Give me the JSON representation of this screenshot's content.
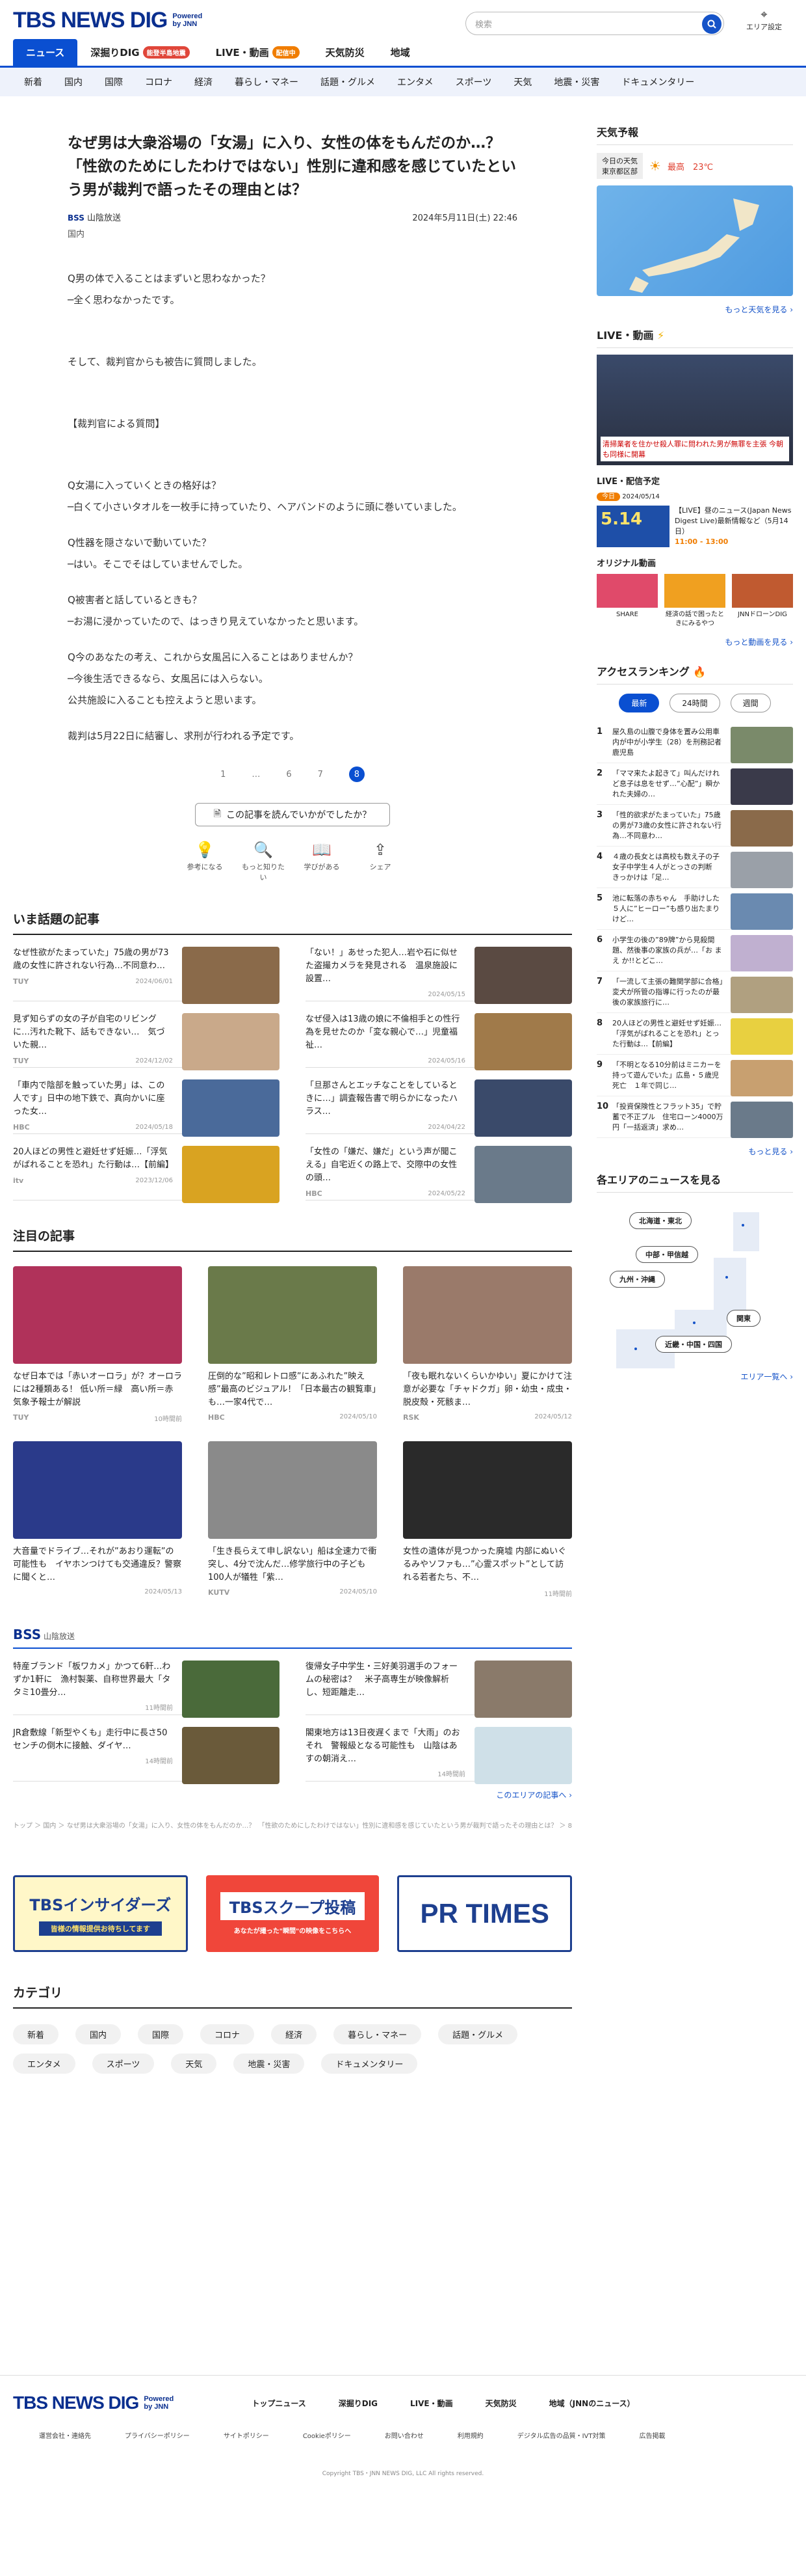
{
  "header": {
    "logo": "TBS NEWS DIG",
    "powered": "Powered by JNN",
    "search_placeholder": "検索",
    "area_label": "エリア設定"
  },
  "nav_main": [
    {
      "label": "ニュース",
      "active": true
    },
    {
      "label": "深掘りDIG",
      "badge": "能登半島地震",
      "badge_color": "#e0463a"
    },
    {
      "label": "LIVE・動画",
      "badge": "配信中",
      "badge_color": "#f07d00"
    },
    {
      "label": "天気防災"
    },
    {
      "label": "地域"
    }
  ],
  "nav_sub": [
    "新着",
    "国内",
    "国際",
    "コロナ",
    "経済",
    "暮らし・マネー",
    "話題・グルメ",
    "エンタメ",
    "スポーツ",
    "天気",
    "地震・災害",
    "ドキュメンタリー"
  ],
  "article": {
    "title": "なぜ男は大衆浴場の「女湯」に入り、女性の体をもんだのか…？　「性欲のためにしたわけではない」性別に違和感を感じていたという男が裁判で語ったその理由とは？",
    "source": "山陰放送",
    "source_logo": "BSS",
    "datetime": "2024年5月11日(土) 22:46",
    "category": "国内",
    "paragraphs": [
      "Q男の体で入ることはまずいと思わなかった？\n─全く思わなかったです。",
      "",
      "そして、裁判官からも被告に質問しました。",
      "",
      "【裁判官による質問】",
      "",
      "Q女湯に入っていくときの格好は？\n─白くて小さいタオルを一枚手に持っていたり、ヘアバンドのように頭に巻いていました。",
      "Q性器を隠さないで動いていた？\n─はい。そこでそはしていませんでした。",
      "Q被害者と話しているときも？\n─お湯に浸かっていたので、はっきり見えていなかったと思います。",
      "Q今のあなたの考え、これから女風呂に入ることはありませんか？\n─今後生活できるなら、女風呂には入らない。\n公共施設に入ることも控えようと思います。",
      "裁判は5月22日に結審し、求刑が行われる予定です。"
    ],
    "pages": [
      "1",
      "…",
      "6",
      "7",
      "8"
    ],
    "current_page": "8",
    "feedback": "この記事を読んでいかがでしたか？",
    "reactions": [
      "参考になる",
      "もっと知りたい",
      "学びがある",
      "シェア"
    ]
  },
  "trending": {
    "title": "いま話題の記事",
    "items": [
      {
        "text": "なぜ性欲がたまっていた」75歳の男が73歳の女性に許されない行為…不同意わ…",
        "src": "TUY",
        "date": "2024/06/01",
        "c": "#8a6a4a"
      },
      {
        "text": "「ない！」あせった犯人…岩や石に似せた盗撮カメラを発見される　温泉施設に設置…",
        "src": "",
        "date": "2024/05/15",
        "c": "#5a4a42"
      },
      {
        "text": "見ず知らずの女の子が自宅のリビングに…汚れた靴下、話もできない…　気づいた親…",
        "src": "TUY",
        "date": "2024/12/02",
        "c": "#c9a98a"
      },
      {
        "text": "なぜ侵入は13歳の娘に不倫相手との性行為を見せたのか「変な親心で…」児童福祉…",
        "src": "",
        "date": "2024/05/16",
        "c": "#a07a4a"
      },
      {
        "text": "「車内で陰部を触っていた男」は、この人です」日中の地下鉄で、真向かいに座った女…",
        "src": "HBC",
        "date": "2024/05/18",
        "c": "#4a6a9a"
      },
      {
        "text": "「旦那さんとエッチなことをしているときに…」調査報告書で明らかになったハラス…",
        "src": "",
        "date": "2024/04/22",
        "c": "#3a4a6a"
      },
      {
        "text": "20人ほどの男性と避妊せず妊娠…「浮気がばれることを恐れ」た行動は…【前編】",
        "src": "itv",
        "date": "2023/12/06",
        "c": "#d9a321"
      },
      {
        "text": "「女性の「嫌だ、嫌だ」という声が聞こえる」自宅近くの路上で、交際中の女性の頭…",
        "src": "HBC",
        "date": "2024/05/22",
        "c": "#6a7a8a"
      }
    ]
  },
  "featured": {
    "title": "注目の記事",
    "items": [
      {
        "text": "なぜ日本では「赤いオーロラ」が？オーロラには2種類ある！ 低い所＝緑　高い所＝赤　気象予報士が解説",
        "src": "TUY",
        "date": "10時間前",
        "c": "#b0325a"
      },
      {
        "text": "圧倒的な”昭和レトロ感”にあふれた”映え感”最高のビジュアル！「日本最古の観覧車」も…一家4代で…",
        "src": "HBC",
        "date": "2024/05/10",
        "c": "#6a7a4a"
      },
      {
        "text": "「夜も眠れないくらいかゆい」夏にかけて注意が必要な「チャドクガ」卵・幼虫・成虫・脱皮殻・死骸ま…",
        "src": "RSK",
        "date": "2024/05/12",
        "c": "#9a7a6a"
      },
      {
        "text": "大音量でドライブ…それが”あおり運転”の可能性も　イヤホンつけても交通違反？警察に聞くと…",
        "src": "",
        "date": "2024/05/13",
        "c": "#2a3a8a"
      },
      {
        "text": "「生き長らえて申し訳ない」船は全速力で衝突し、4分で沈んだ…修学旅行中の子ども100人が犠牲「紫…",
        "src": "KUTV",
        "date": "2024/05/10",
        "c": "#8a8a8a"
      },
      {
        "text": "女性の遺体が見つかった廃墟 内部にぬいぐるみやソファも…”心霊スポット”として訪れる若者たち、不…",
        "src": "",
        "date": "11時間前",
        "c": "#2a2a2a"
      }
    ]
  },
  "local": {
    "logo": "BSS",
    "name": "山陰放送",
    "items": [
      {
        "text": "特産ブランド「板ワカメ」かつて6軒…わずか1軒に　漁村製薬、自称世界最大「タタミ10畳分…",
        "date": "11時間前",
        "c": "#4a6a3a"
      },
      {
        "text": "復帰女子中学生・三好美羽選手のフォームの秘密は？　米子高専生が映像解析し、短距離走…",
        "date": "",
        "c": "#8a7a6a"
      },
      {
        "text": "JR倉敷線「新型やくも」走行中に長さ50センチの倒木に接触、ダイヤ…",
        "date": "14時間前",
        "c": "#6a5a3a"
      },
      {
        "text": "閣東地方は13日夜遅くまで「大雨」のおそれ　警報級となる可能性も　山陰はあすの朝消え…",
        "date": "14時間前",
        "c": "#cfe0e8"
      }
    ],
    "more": "このエリアの記事へ ›"
  },
  "breadcrumb": "トップ ＞ 国内 ＞ なぜ男は大衆浴場の「女湯」に入り、女性の体をもんだのか…？　「性欲のためにしたわけではない」性別に違和感を感じていたという男が裁判で語ったその理由とは？ ＞ 8ページ目",
  "banners": [
    "TBSインサイダーズ",
    "皆様の情報提供お待ちしてます",
    "TBSスクープ投稿",
    "あなたが撮った\"瞬間\"の映像をこちらへ",
    "PR TIMES"
  ],
  "categories": {
    "title": "カテゴリ",
    "items": [
      "新着",
      "国内",
      "国際",
      "コロナ",
      "経済",
      "暮らし・マネー",
      "話題・グルメ",
      "エンタメ",
      "スポーツ",
      "天気",
      "地震・災害",
      "ドキュメンタリー"
    ]
  },
  "footer": {
    "links": [
      "トップニュース",
      "深掘りDIG",
      "LIVE・動画",
      "天気防災",
      "地域（JNNのニュース）"
    ],
    "sub": [
      "運営会社・連絡先",
      "プライバシーポリシー",
      "サイトポリシー",
      "Cookieポリシー",
      "お問い合わせ",
      "利用規約",
      "デジタル広告の品質・IVT対策",
      "広告掲載"
    ],
    "copyright": "Copyright TBS・JNN NEWS DIG, LLC All rights reserved."
  },
  "sidebar": {
    "weather_title": "天気予報",
    "weather_place": "今日の天気\n東京都区部",
    "weather_temp": "最高　23℃",
    "weather_more": "もっと天気を見る ›",
    "live_title": "LIVE・動画",
    "live_caption": "清掃業者を住かせ殺人罪に問われた男が無罪を主張 今朝も同様に開幕",
    "live_sched_title": "LIVE・配信予定",
    "live_sched_badge": "今日",
    "live_sched_date": "2024/05/14",
    "live_sched_text": "【LIVE】昼のニュース(Japan News Digest Live)最新情報など（5月14日）",
    "live_sched_time": "11:00 - 13:00",
    "original_title": "オリジナル動画",
    "originals": [
      "SHARE",
      "経済の話で困ったときにみるやつ",
      "JNNドローンDIG"
    ],
    "video_more": "もっと動画を見る ›",
    "ranking_title": "アクセスランキング",
    "ranking_tabs": [
      "最新",
      "24時間",
      "週間"
    ],
    "ranking": [
      "屋久島の山腹で身体を置み公用車内が中が小学生（28）を刑務記者　鹿児島",
      "「ママ来たよ起きて」叫んだけれど息子は息をせず…”心配”」瞬かれた夫婦の…",
      "「性的欲求がたまっていた」75歳の男が73歳の女性に許されない行為…不同意わ…",
      "４歳の長女とは高校も数え子の子　女子中学生４人がとっさの判断　きっかけは「足…",
      "池に転落の赤ちゃん　手助けした５人に”ヒーロー”も感り出たまりけど…",
      "小学生の後の”89牌”から見殺間題、然後事の家族の兵が…「お まえ か!!とどこ…",
      "「一流して主張の難関学部に合格」変犬が所管の指導に行ったのが最後の家族旅行に…",
      "20人ほどの男性と避妊せず妊娠…「浮気がばれることを恐れ」とった行動は…【前編】",
      "「不明となる10分前はミニカーを持って遊んでいた」広島・５歳児死亡　１年で同じ…",
      "「投資保険性とフラット35」で貯蓄で不正プル　住宅ローン4000万円「一括返済」求め…"
    ],
    "ranking_colors": [
      "#7a8a6a",
      "#3a3a4a",
      "#8a6a4a",
      "#9aa0a8",
      "#6a8ab0",
      "#c0b0d0",
      "#b0a080",
      "#e8d040",
      "#c8a070",
      "#6a7a8a"
    ],
    "ranking_more": "もっと見る ›",
    "area_title": "各エリアのニュースを見る",
    "areas": [
      "北海道・東北",
      "中部・甲信越",
      "九州・沖縄",
      "関東",
      "近畿・中国・四国"
    ],
    "area_more": "エリア一覧へ ›"
  }
}
